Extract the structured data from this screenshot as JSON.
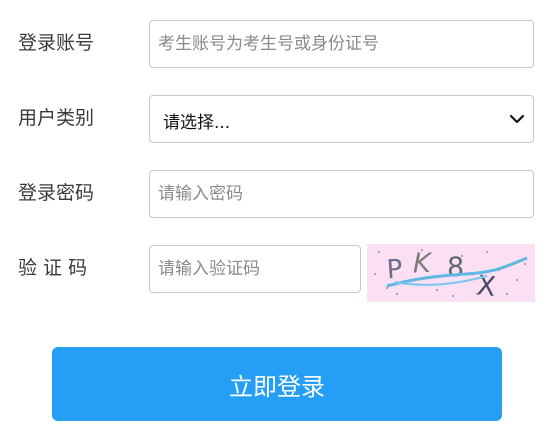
{
  "form": {
    "account": {
      "label": "登录账号",
      "placeholder": "考生账号为考生号或身份证号",
      "value": ""
    },
    "user_type": {
      "label": "用户类别",
      "selected": "请选择..."
    },
    "password": {
      "label": "登录密码",
      "placeholder": "请输入密码",
      "value": ""
    },
    "captcha": {
      "label": "验 证 码",
      "placeholder": "请输入验证码",
      "value": "",
      "image_text": "PK8X"
    },
    "submit_label": "立即登录"
  }
}
